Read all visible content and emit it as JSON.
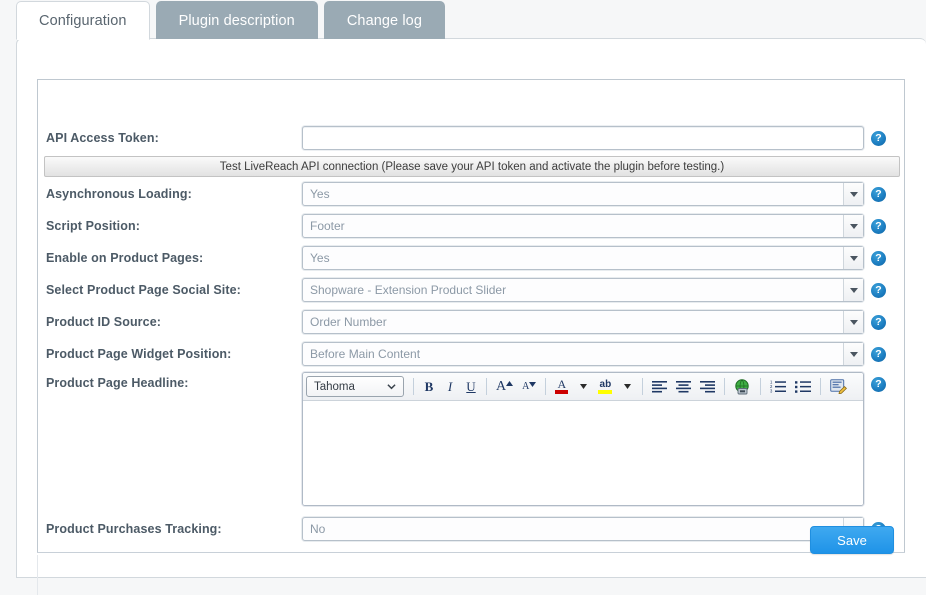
{
  "tabs": [
    {
      "label": "Configuration",
      "active": true
    },
    {
      "label": "Plugin description",
      "active": false
    },
    {
      "label": "Change log",
      "active": false
    }
  ],
  "test_button": {
    "label": "Test LiveReach API connection (Please save your API token and activate the plugin before testing.)"
  },
  "help_icon": {
    "glyph": "?"
  },
  "fields": [
    {
      "name": "api-access-token",
      "label": "API Access Token:",
      "type": "text",
      "value": "",
      "placeholder": ""
    },
    {
      "name": "asynchronous-loading",
      "label": "Asynchronous Loading:",
      "type": "select",
      "value": "Yes"
    },
    {
      "name": "script-position",
      "label": "Script Position:",
      "type": "select",
      "value": "Footer"
    },
    {
      "name": "enable-on-product-pages",
      "label": "Enable on Product Pages:",
      "type": "select",
      "value": "Yes"
    },
    {
      "name": "select-product-page-social-site",
      "label": "Select Product Page Social Site:",
      "type": "select",
      "value": "Shopware - Extension Product Slider"
    },
    {
      "name": "product-id-source",
      "label": "Product ID Source:",
      "type": "select",
      "value": "Order Number"
    },
    {
      "name": "product-page-widget-position",
      "label": "Product Page Widget Position:",
      "type": "select",
      "value": "Before Main Content"
    },
    {
      "name": "product-page-headline",
      "label": "Product Page Headline:",
      "type": "editor",
      "value": ""
    },
    {
      "name": "product-purchases-tracking",
      "label": "Product Purchases Tracking:",
      "type": "select",
      "value": "No"
    }
  ],
  "editor": {
    "font_family_value": "Tahoma",
    "toolbar": [
      {
        "name": "bold-icon",
        "glyph": "B"
      },
      {
        "name": "italic-icon",
        "glyph": "I"
      },
      {
        "name": "underline-icon",
        "glyph": "U"
      },
      {
        "name": "grow-font-icon",
        "glyph": "A"
      },
      {
        "name": "shrink-font-icon",
        "glyph": "A"
      },
      {
        "name": "font-color-icon",
        "glyph": "A"
      },
      {
        "name": "text-highlight-icon",
        "glyph": "ab"
      },
      {
        "name": "align-left-icon",
        "glyph": ""
      },
      {
        "name": "align-center-icon",
        "glyph": ""
      },
      {
        "name": "align-right-icon",
        "glyph": ""
      },
      {
        "name": "insert-link-icon",
        "glyph": ""
      },
      {
        "name": "numbered-list-icon",
        "glyph": ""
      },
      {
        "name": "bullet-list-icon",
        "glyph": ""
      },
      {
        "name": "source-code-icon",
        "glyph": ""
      }
    ]
  },
  "footer": {
    "save_label": "Save"
  },
  "colors": {
    "tab_inactive": "#9aaab4",
    "accent_blue": "#1f93e8",
    "help_blue": "#1b7cc0",
    "label_text": "#4c5a66",
    "placeholder_text": "#8c99a6"
  }
}
